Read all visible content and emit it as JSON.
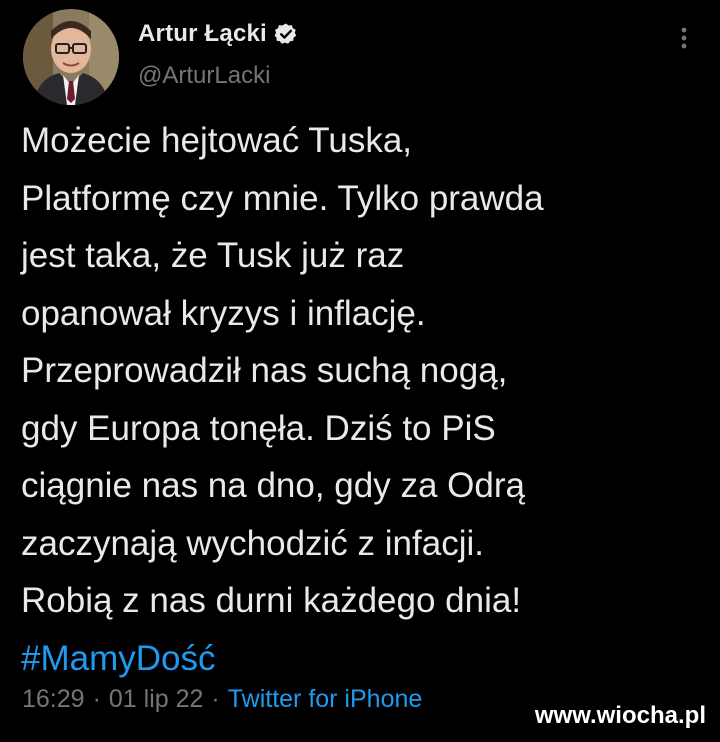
{
  "author": {
    "display_name": "Artur Łącki",
    "handle": "@ArturLacki",
    "verified_icon": "verified-badge-icon",
    "avatar": "profile-photo"
  },
  "header": {
    "more_icon": "more-options-icon"
  },
  "tweet": {
    "lines": [
      "Możecie hejtować Tuska,",
      "Platformę czy mnie. Tylko prawda",
      "jest taka, że Tusk już raz",
      "opanował kryzys i inflację.",
      "Przeprowadził nas suchą nogą,",
      "gdy Europa tonęła. Dziś to PiS",
      "ciągnie nas na dno, gdy za Odrą",
      "zaczynają wychodzić z infacji.",
      "Robią z nas durni każdego dnia!"
    ],
    "hashtag": "#MamyDość"
  },
  "meta": {
    "time": "16:29",
    "separator": "·",
    "date": "01 lip 22",
    "source": "Twitter for iPhone"
  },
  "watermark": {
    "text": "www.wiocha.pl"
  },
  "colors": {
    "background": "#000000",
    "text": "#e7e9ea",
    "muted": "#71767b",
    "accent": "#1d9bf0"
  }
}
